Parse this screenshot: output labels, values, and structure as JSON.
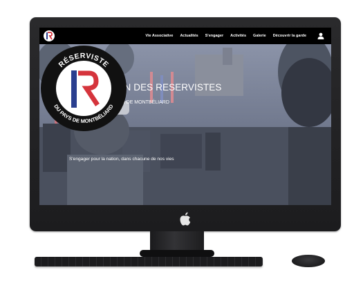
{
  "nav": {
    "items": [
      "Vie Associative",
      "Actualités",
      "S'engager",
      "Activités",
      "Galerie",
      "Découvrir la garde"
    ]
  },
  "hero": {
    "title": "ASSOCIATION DES RESERVISTES",
    "subtitle": "DU PAYS DE MONTBÉLIARD",
    "tagline": "S'engager pour la nation, dans chacune de nos vies"
  },
  "badge": {
    "top_text": "RÉSERVISTE",
    "bottom_text": "DU PAYS DE MONTBÉLIARD"
  },
  "colors": {
    "nav_bg": "#000000",
    "badge_red": "#d5343c",
    "badge_blue": "#2a3f8f",
    "badge_ring": "#111111"
  },
  "icons": [
    "site-logo-icon",
    "user-icon",
    "apple-logo-icon"
  ]
}
